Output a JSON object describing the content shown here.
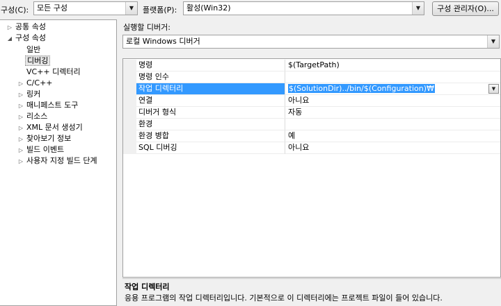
{
  "toolbar": {
    "config_label": "구성(C):",
    "config_value": "모든 구성",
    "platform_label": "플랫폼(P):",
    "platform_value": "활성(Win32)",
    "config_manager_button": "구성 관리자(O)..."
  },
  "tree": {
    "items": [
      {
        "label": "공통 속성",
        "state": "collapsed"
      },
      {
        "label": "구성 속성",
        "state": "expanded"
      },
      {
        "label": "일반",
        "state": "leaf"
      },
      {
        "label": "디버깅",
        "state": "leaf",
        "selected": true
      },
      {
        "label": "VC++ 디렉터리",
        "state": "leaf"
      },
      {
        "label": "C/C++",
        "state": "collapsed"
      },
      {
        "label": "링커",
        "state": "collapsed"
      },
      {
        "label": "매니페스트 도구",
        "state": "collapsed"
      },
      {
        "label": "리소스",
        "state": "collapsed"
      },
      {
        "label": "XML 문서 생성기",
        "state": "collapsed"
      },
      {
        "label": "찾아보기 정보",
        "state": "collapsed"
      },
      {
        "label": "빌드 이벤트",
        "state": "collapsed"
      },
      {
        "label": "사용자 지정 빌드 단계",
        "state": "collapsed"
      }
    ]
  },
  "debugger": {
    "label": "실행할 디버거:",
    "value": "로컬 Windows 디버거"
  },
  "properties": [
    {
      "name": "명령",
      "value": "$(TargetPath)"
    },
    {
      "name": "명령 인수",
      "value": ""
    },
    {
      "name": "작업 디렉터리",
      "value": "$(SolutionDir)../bin/$(Configuration)₩",
      "selected": true
    },
    {
      "name": "연결",
      "value": "아니요"
    },
    {
      "name": "디버거 형식",
      "value": "자동"
    },
    {
      "name": "환경",
      "value": ""
    },
    {
      "name": "환경 병합",
      "value": "예"
    },
    {
      "name": "SQL 디버깅",
      "value": "아니요"
    }
  ],
  "description": {
    "title": "작업 디렉터리",
    "body": "응용 프로그램의 작업 디렉터리입니다. 기본적으로 이 디렉터리에는 프로젝트 파일이 들어 있습니다."
  },
  "icons": {
    "collapsed": "▷",
    "expanded": "◢",
    "dropdown": "▼"
  }
}
